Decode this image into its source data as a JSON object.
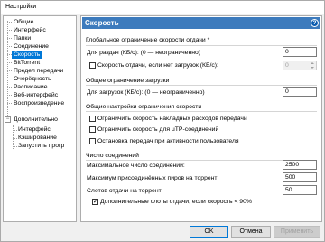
{
  "window": {
    "title": "Настройки"
  },
  "tree": {
    "items": [
      {
        "label": "Общие"
      },
      {
        "label": "Интерфейс"
      },
      {
        "label": "Папки"
      },
      {
        "label": "Соединение"
      },
      {
        "label": "Скорость"
      },
      {
        "label": "BitTorrent"
      },
      {
        "label": "Предел передачи"
      },
      {
        "label": "Очерёдность"
      },
      {
        "label": "Расписание"
      },
      {
        "label": "Веб-интерфейс"
      },
      {
        "label": "Воспроизведение"
      },
      {
        "label": "Дополнительно"
      },
      {
        "label": "Интерфейс"
      },
      {
        "label": "Кэширование"
      },
      {
        "label": "Запустить прогр"
      }
    ]
  },
  "pane": {
    "title": "Скорость",
    "global": {
      "title": "Глобальное ограничение скорости отдачи *",
      "upload_label": "Для раздач (КБ/с): (0 — неограниченно)",
      "upload_value": "0",
      "no_dl_label": "Скорость отдачи, если нет загрузок (КБ/с):",
      "no_dl_value": "0"
    },
    "download": {
      "title": "Общее ограничение загрузки",
      "dl_label": "Для загрузок (КБ/с): (0 — неограниченно)",
      "dl_value": "0"
    },
    "speed_settings": {
      "title": "Общие настройки ограничения скорости",
      "opt1": "Ограничить скорость накладных расходов передачи",
      "opt2": "Ограничить скорость для uTP-соединений",
      "opt3": "Остановка передач при активности пользователя"
    },
    "connections": {
      "title": "Число соединений",
      "max_label": "Максимальное число соединений:",
      "max_value": "2500",
      "peers_label": "Максимум присоединённых пиров на торрент:",
      "peers_value": "500",
      "slots_label": "Слотов отдачи на торрент:",
      "slots_value": "50",
      "extra_label": "Дополнительные слоты отдачи, если скорость < 90%"
    }
  },
  "buttons": {
    "ok": "OK",
    "cancel": "Отмена",
    "apply": "Применить"
  }
}
